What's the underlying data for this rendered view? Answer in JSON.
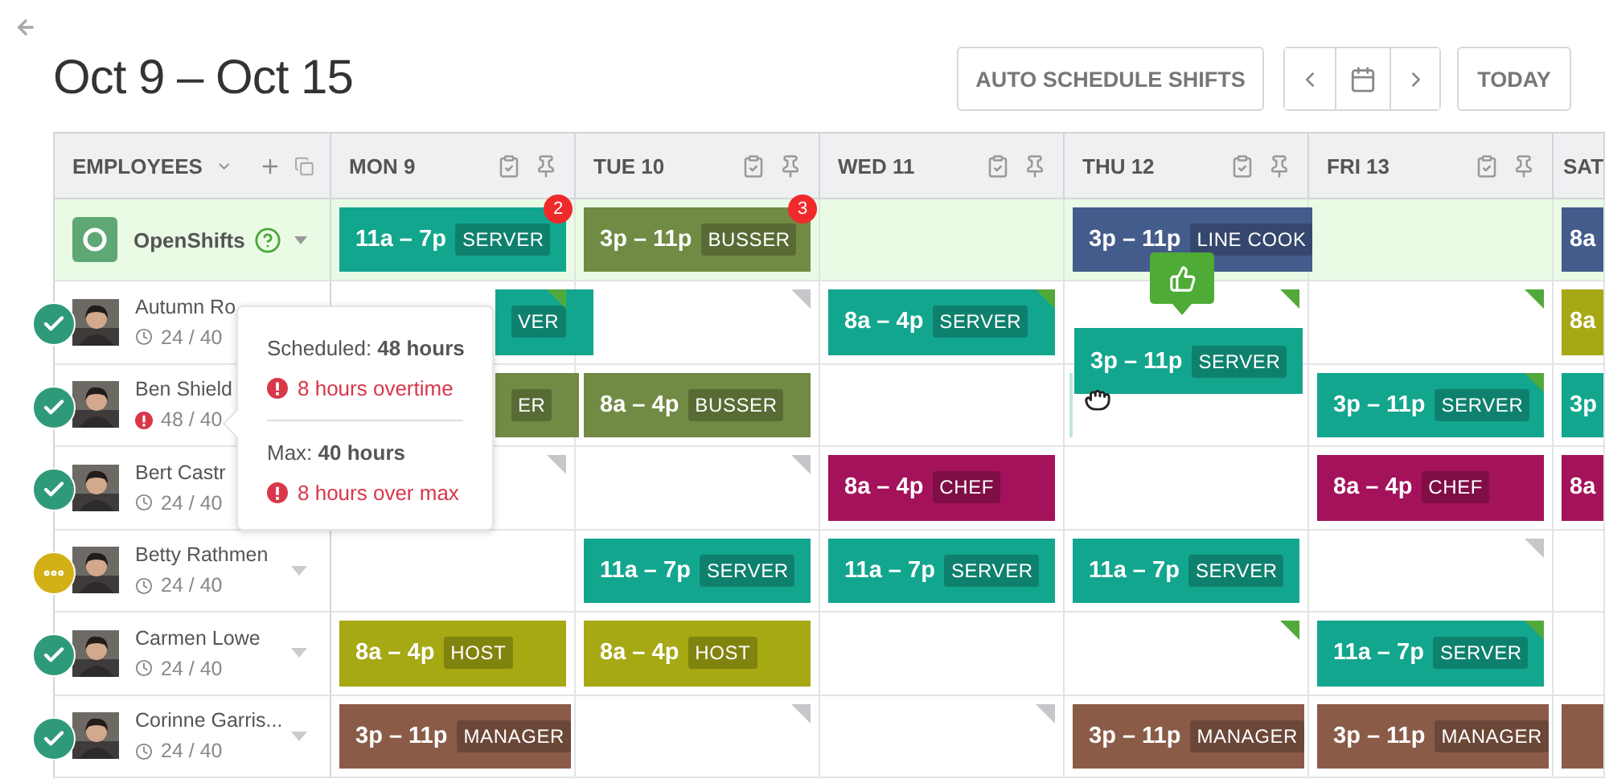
{
  "title": "Oct 9 – Oct 15",
  "toolbar": {
    "auto_schedule": "AUTO SCHEDULE SHIFTS",
    "today": "TODAY"
  },
  "header": {
    "employees": "EMPLOYEES",
    "days": [
      "MON 9",
      "TUE 10",
      "WED 11",
      "THU 12",
      "FRI 13",
      "SAT"
    ]
  },
  "open_shifts": {
    "label": "OpenShifts",
    "cells": [
      {
        "shift": {
          "time": "11a – 7p",
          "role": "SERVER",
          "color": "#13a68e",
          "badge": "2"
        }
      },
      {
        "shift": {
          "time": "3p – 11p",
          "role": "BUSSER",
          "color": "#718a44",
          "badge": "3"
        }
      },
      {},
      {
        "shift": {
          "time": "3p – 11p",
          "role": "LINE COOK",
          "color": "#445c8b"
        }
      },
      {},
      {
        "shift": {
          "time": "8a",
          "color": "#445c8b"
        }
      }
    ]
  },
  "employees": [
    {
      "name": "Autumn Ro",
      "hours": "24 / 40",
      "confirmed": true,
      "over": false,
      "caret": false,
      "cells": [
        {
          "shift": {
            "role": "VER",
            "color": "#13a68e",
            "covered": true
          },
          "flag": {
            "color": "#52a93b"
          }
        },
        {
          "flag": {
            "color": "#c5c7ca"
          }
        },
        {
          "shift": {
            "time": "8a – 4p",
            "role": "SERVER",
            "color": "#13a68e"
          },
          "flag": {
            "color": "#52a93b"
          }
        },
        {
          "flag": {
            "color": "#52a93b"
          },
          "dragging": {
            "time": "3p – 11p",
            "role": "SERVER",
            "color": "#13a68e"
          }
        },
        {
          "flag": {
            "color": "#52a93b"
          }
        },
        {
          "shift": {
            "time": "8a",
            "color": "#a6a814"
          }
        }
      ]
    },
    {
      "name": "Ben Shield",
      "hours": "48 / 40",
      "confirmed": true,
      "over": true,
      "caret": false,
      "cells": [
        {
          "shift": {
            "role": "ER",
            "color": "#718a44",
            "covered": true
          }
        },
        {
          "shift": {
            "time": "8a – 4p",
            "role": "BUSSER",
            "color": "#718a44"
          }
        },
        {},
        {
          "drop_target": true
        },
        {
          "shift": {
            "time": "3p – 11p",
            "role": "SERVER",
            "color": "#13a68e"
          },
          "flag": {
            "color": "#52a93b"
          }
        },
        {
          "shift": {
            "time": "3p",
            "color": "#13a68e"
          }
        }
      ]
    },
    {
      "name": "Bert Castr",
      "hours": "24 / 40",
      "confirmed": true,
      "over": false,
      "caret": false,
      "cells": [
        {
          "flag": {
            "color": "#c5c7ca"
          }
        },
        {
          "flag": {
            "color": "#c5c7ca"
          }
        },
        {
          "shift": {
            "time": "8a – 4p",
            "role": "CHEF",
            "color": "#a3125a"
          }
        },
        {},
        {
          "shift": {
            "time": "8a – 4p",
            "role": "CHEF",
            "color": "#a3125a"
          }
        },
        {
          "shift": {
            "time": "8a",
            "color": "#a3125a"
          }
        }
      ]
    },
    {
      "name": "Betty Rathmen",
      "hours": "24 / 40",
      "confirmed": false,
      "over": false,
      "caret": true,
      "cells": [
        {},
        {
          "shift": {
            "time": "11a – 7p",
            "role": "SERVER",
            "color": "#13a68e"
          }
        },
        {
          "shift": {
            "time": "11a – 7p",
            "role": "SERVER",
            "color": "#13a68e"
          }
        },
        {
          "shift": {
            "time": "11a – 7p",
            "role": "SERVER",
            "color": "#13a68e"
          }
        },
        {
          "flag": {
            "color": "#c5c7ca"
          }
        },
        {}
      ]
    },
    {
      "name": "Carmen Lowe",
      "hours": "24 / 40",
      "confirmed": true,
      "over": false,
      "caret": true,
      "cells": [
        {
          "shift": {
            "time": "8a – 4p",
            "role": "HOST",
            "color": "#a6a814"
          }
        },
        {
          "shift": {
            "time": "8a – 4p",
            "role": "HOST",
            "color": "#a6a814"
          }
        },
        {},
        {
          "flag": {
            "color": "#52a93b"
          }
        },
        {
          "shift": {
            "time": "11a – 7p",
            "role": "SERVER",
            "color": "#13a68e"
          },
          "flag": {
            "color": "#52a93b"
          }
        },
        {}
      ]
    },
    {
      "name": "Corinne Garris...",
      "hours": "24 / 40",
      "confirmed": true,
      "over": false,
      "caret": true,
      "cells": [
        {
          "shift": {
            "time": "3p – 11p",
            "role": "MANAGER",
            "color": "#8a5c47"
          }
        },
        {
          "flag": {
            "color": "#c5c7ca"
          }
        },
        {
          "flag": {
            "color": "#c5c7ca"
          }
        },
        {
          "shift": {
            "time": "3p – 11p",
            "role": "MANAGER",
            "color": "#8a5c47"
          }
        },
        {
          "shift": {
            "time": "3p – 11p",
            "role": "MANAGER",
            "color": "#8a5c47"
          }
        },
        {
          "shift": {
            "color": "#8a5c47"
          }
        }
      ]
    }
  ],
  "popover": {
    "sections": [
      {
        "label": "Scheduled: **48 hours**",
        "alert": "8 hours overtime"
      },
      {
        "label": "Max: **40 hours**",
        "alert": "8 hours over max"
      }
    ]
  }
}
